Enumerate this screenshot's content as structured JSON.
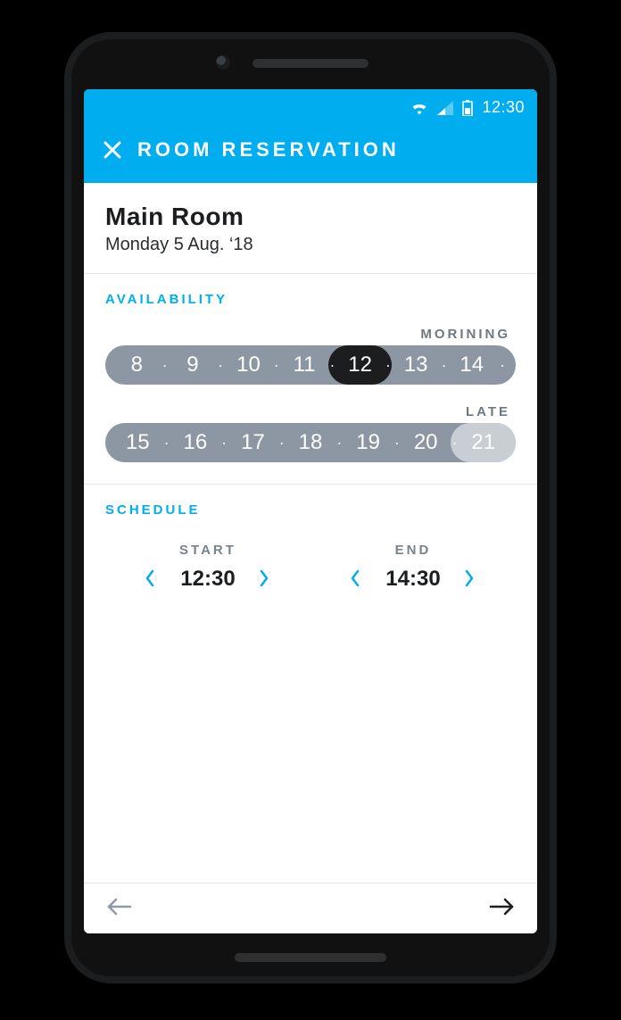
{
  "statusbar": {
    "time": "12:30"
  },
  "appbar": {
    "title": "ROOM RESERVATION"
  },
  "room": {
    "name": "Main Room",
    "date": "Monday 5 Aug.  ‘18"
  },
  "availability": {
    "heading": "AVAILABILITY",
    "morning": {
      "label": "MORINING",
      "hours": [
        "8",
        "9",
        "10",
        "11",
        "12",
        "13",
        "14"
      ],
      "selected_index": 4,
      "trailing_dot": true
    },
    "late": {
      "label": "LATE",
      "hours": [
        "15",
        "16",
        "17",
        "18",
        "19",
        "20",
        "21"
      ],
      "closed_last": true
    }
  },
  "schedule": {
    "heading": "SCHEDULE",
    "start_label": "START",
    "end_label": "END",
    "start": "12:30",
    "end": "14:30"
  }
}
